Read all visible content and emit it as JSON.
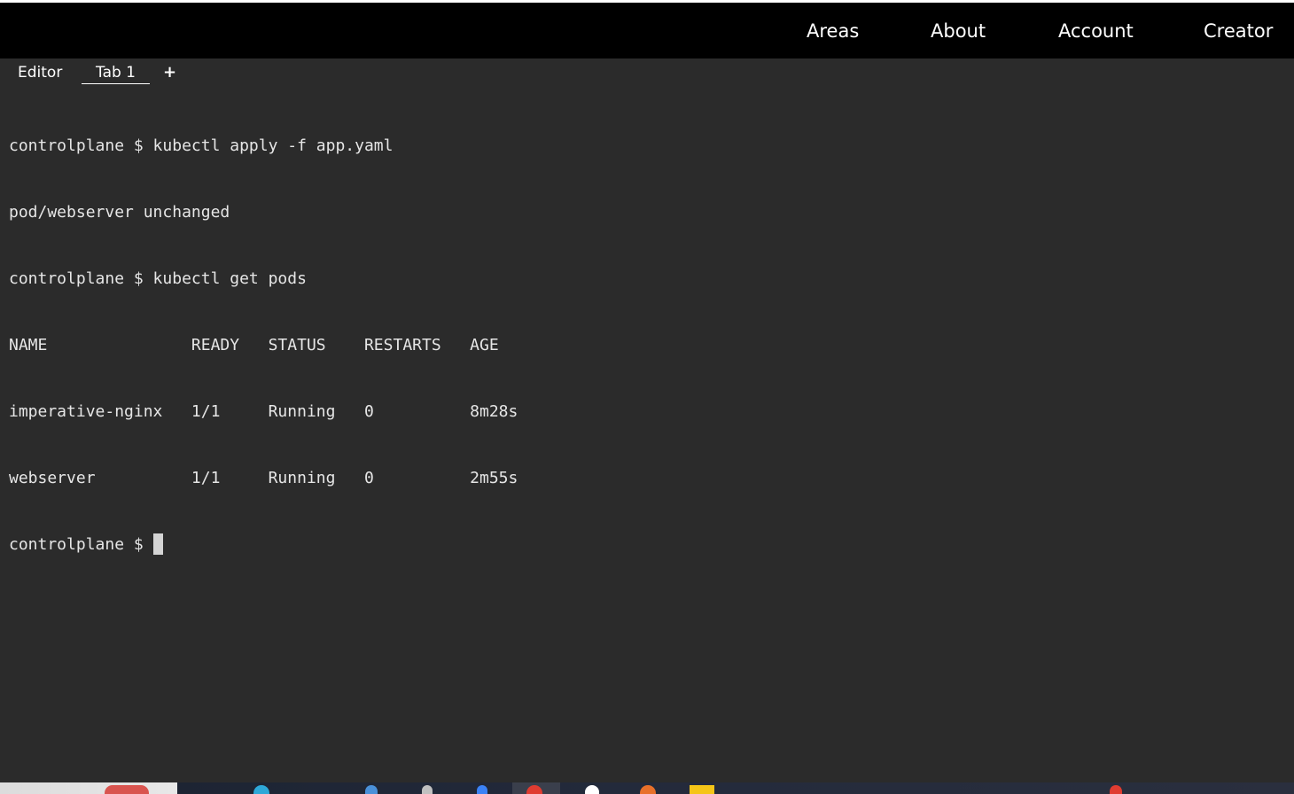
{
  "nav": {
    "links": [
      "Areas",
      "About",
      "Account",
      "Creator"
    ]
  },
  "tabs": {
    "editor": "Editor",
    "tab1": "Tab 1",
    "add": "+"
  },
  "terminal": {
    "lines": [
      "controlplane $ kubectl apply -f app.yaml",
      "pod/webserver unchanged",
      "controlplane $ kubectl get pods",
      "NAME               READY   STATUS    RESTARTS   AGE",
      "imperative-nginx   1/1     Running   0          8m28s",
      "webserver          1/1     Running   0          2m55s"
    ],
    "prompt": "controlplane $ "
  },
  "colors": {
    "navbar_bg": "#000000",
    "terminal_bg": "#2b2b2b",
    "text": "#e6e6e6",
    "cursor": "#d4d4d4",
    "taskbar_icons": [
      "#d9544f",
      "#2ea8d8",
      "#4a90d9",
      "#c0c0c0",
      "#3b82f6",
      "#e03c31",
      "#ffffff",
      "#e8702a",
      "#f5c518",
      "#e03c31"
    ]
  }
}
